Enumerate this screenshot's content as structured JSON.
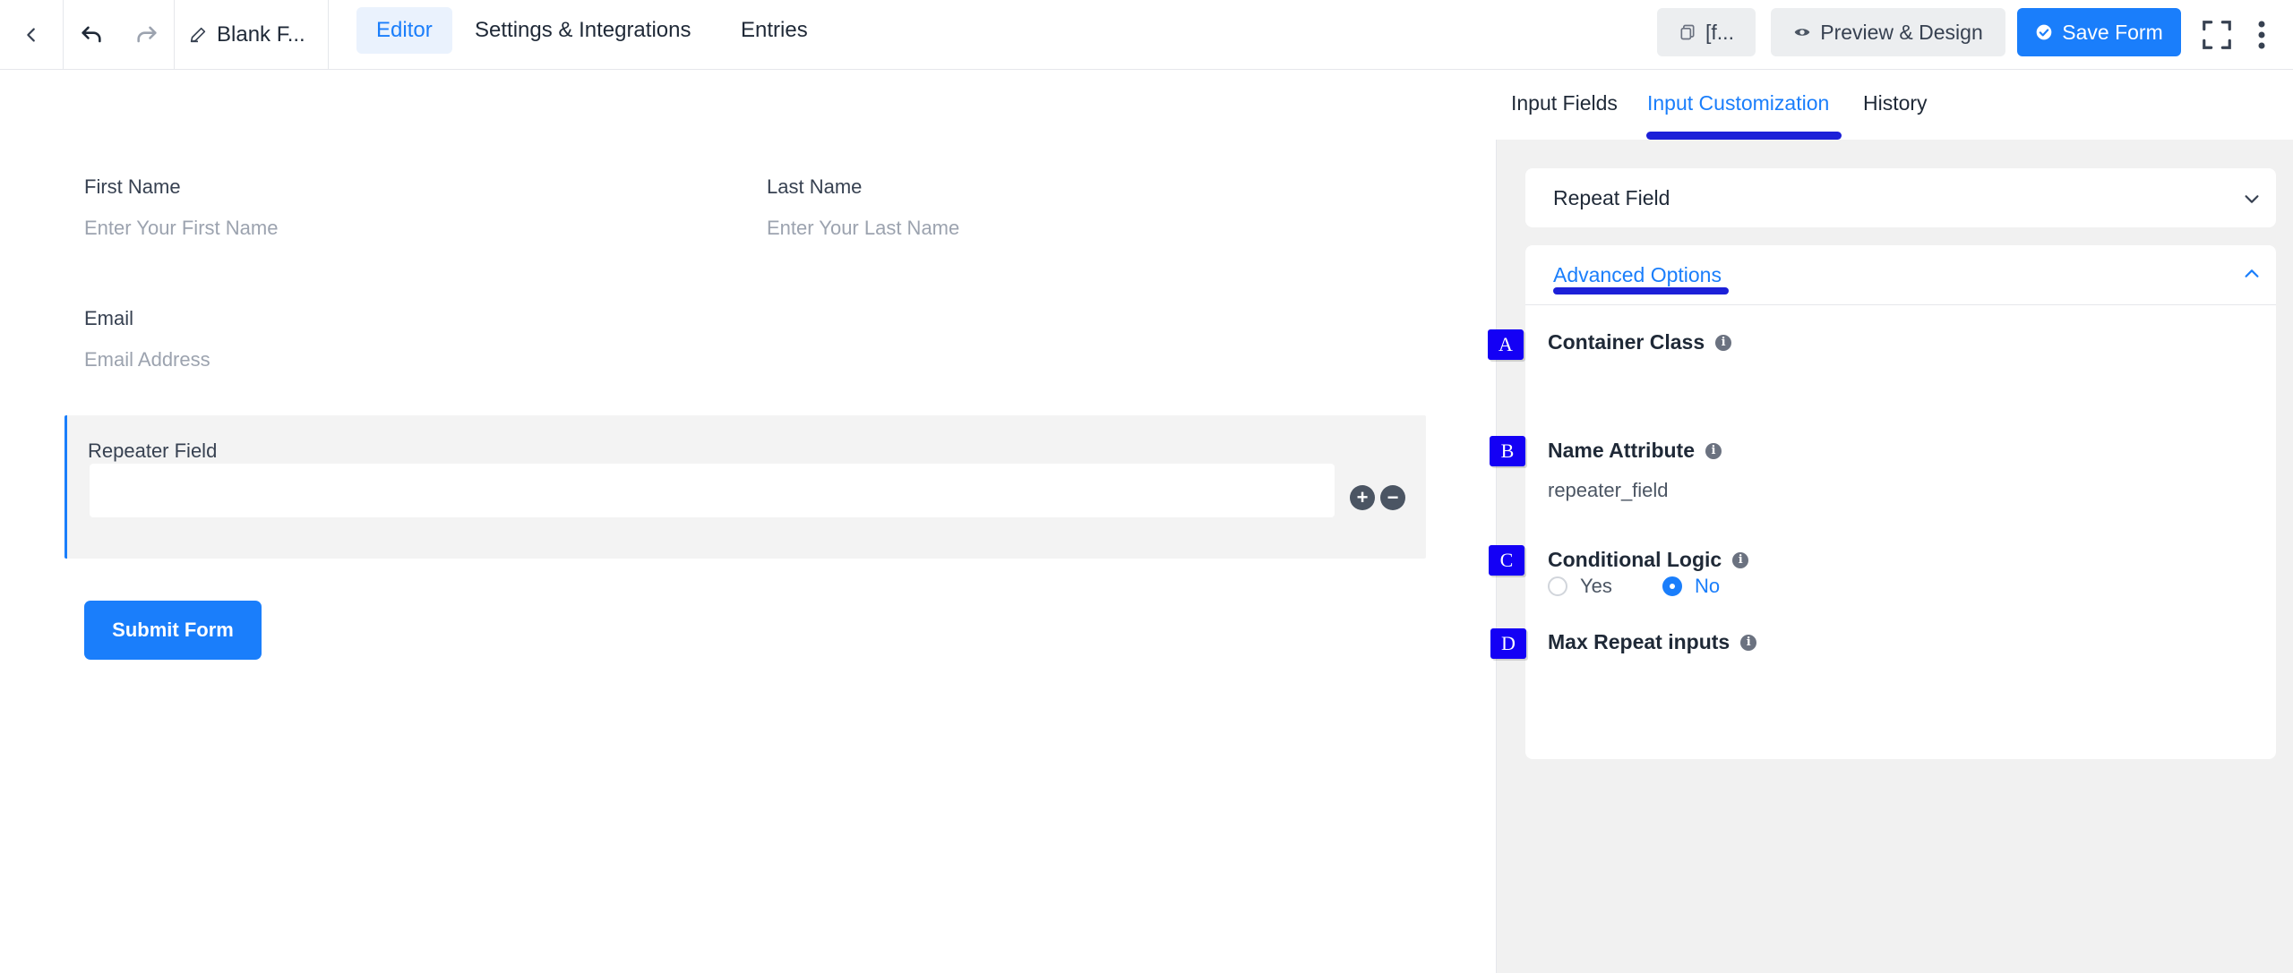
{
  "topbar": {
    "doc_title": "Blank F...",
    "nav_tabs": [
      "Editor",
      "Settings & Integrations",
      "Entries"
    ],
    "shortcode_label": "[f...",
    "preview_label": "Preview & Design",
    "save_label": "Save Form"
  },
  "form": {
    "first_name_label": "First Name",
    "first_name_placeholder": "Enter Your First Name",
    "last_name_label": "Last Name",
    "last_name_placeholder": "Enter Your Last Name",
    "email_label": "Email",
    "email_placeholder": "Email Address",
    "repeater_label": "Repeater Field",
    "submit_label": "Submit Form"
  },
  "sidebar": {
    "tabs": [
      "Input Fields",
      "Input Customization",
      "History"
    ],
    "active_tab": "Input Customization",
    "repeat_field_title": "Repeat Field",
    "advanced_options_title": "Advanced Options",
    "fields": {
      "container_class": {
        "badge": "A",
        "label": "Container Class"
      },
      "name_attribute": {
        "badge": "B",
        "label": "Name Attribute",
        "value": "repeater_field"
      },
      "conditional_logic": {
        "badge": "C",
        "label": "Conditional Logic",
        "options": [
          "Yes",
          "No"
        ],
        "selected": "No"
      },
      "max_repeat": {
        "badge": "D",
        "label": "Max Repeat inputs"
      }
    }
  },
  "colors": {
    "accent": "#1a7efb",
    "annotation": "#1400f5"
  }
}
